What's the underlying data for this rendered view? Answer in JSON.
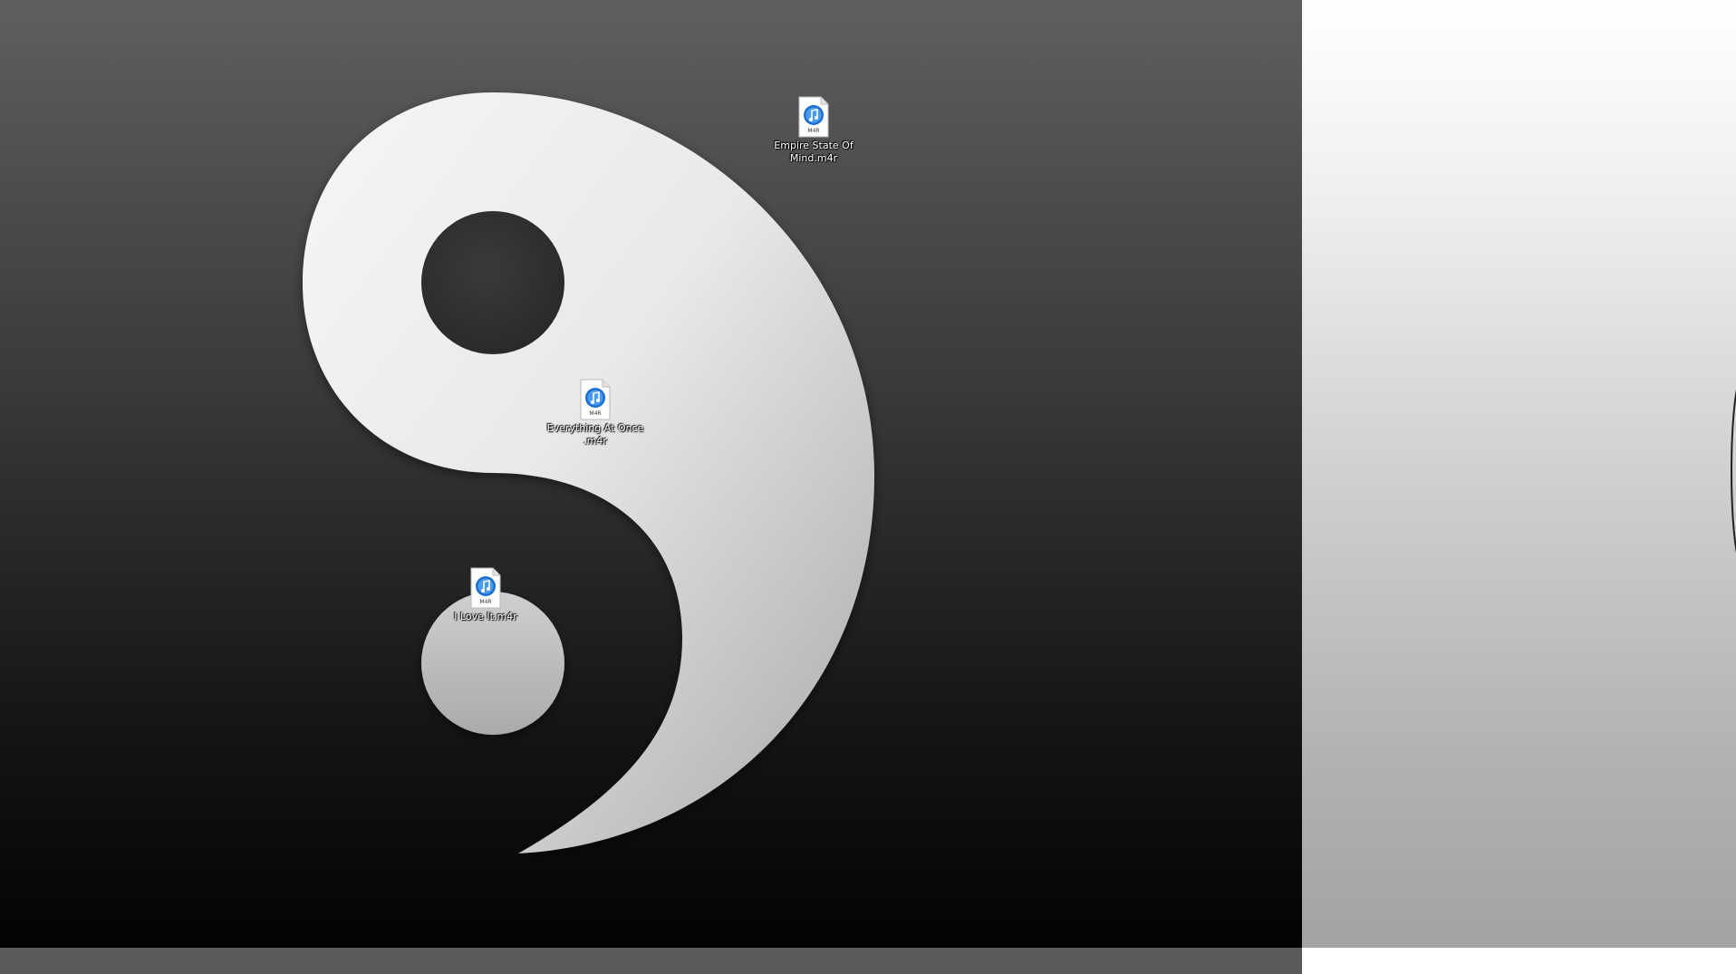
{
  "desktop": {
    "icons": [
      {
        "label": "Empire State Of Mind.m4r",
        "badge": "M4R",
        "icon": "itunes-ringtone-icon"
      },
      {
        "label": "Everything At Once .m4r",
        "badge": "M4R",
        "icon": "itunes-ringtone-icon"
      },
      {
        "label": "I Love It.m4r",
        "badge": "M4R",
        "icon": "itunes-ringtone-icon"
      }
    ]
  },
  "colors": {
    "music_badge": "#1b6fd0",
    "wallpaper_left_top": "#5f5f5f",
    "wallpaper_left_bottom": "#030303",
    "wallpaper_right_top": "#ffffff",
    "wallpaper_right_bottom": "#a3a3a3",
    "taskbar": "#5a5a5a"
  }
}
